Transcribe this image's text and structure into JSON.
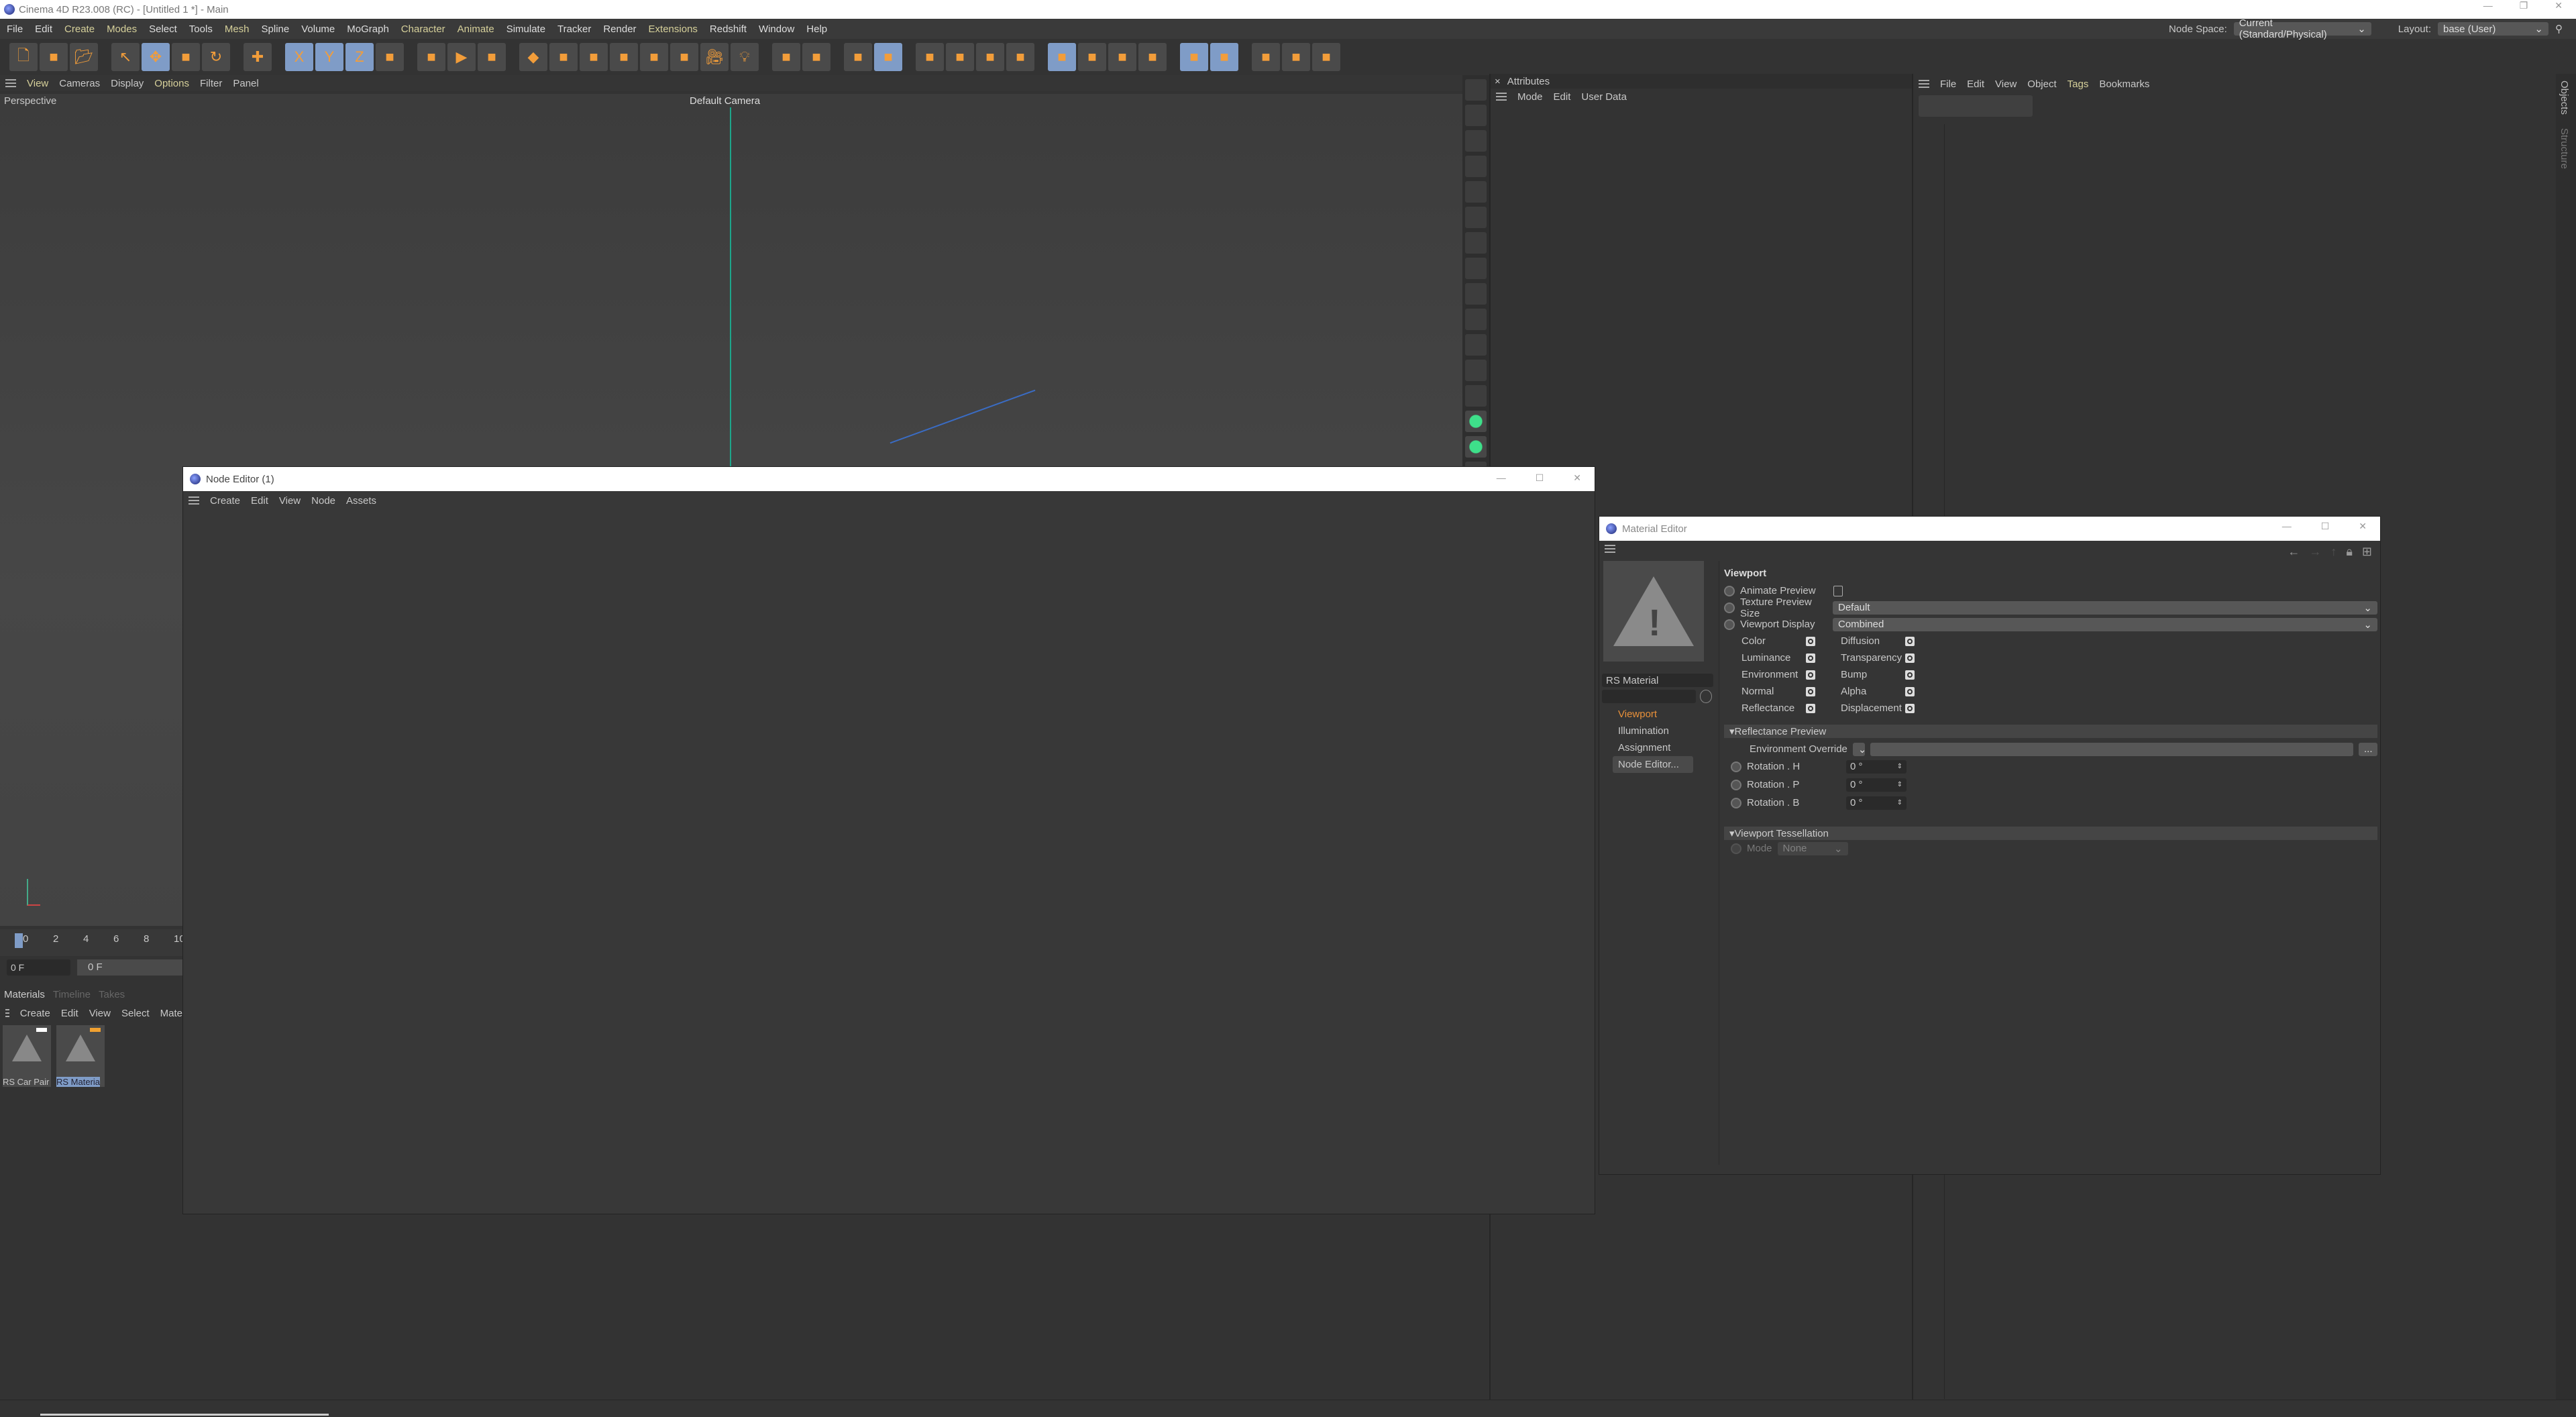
{
  "app": {
    "title": "Cinema 4D R23.008 (RC) - [Untitled 1 *] - Main"
  },
  "menu": [
    {
      "label": "File"
    },
    {
      "label": "Edit"
    },
    {
      "label": "Create",
      "y": true
    },
    {
      "label": "Modes",
      "y": true
    },
    {
      "label": "Select"
    },
    {
      "label": "Tools"
    },
    {
      "label": "Mesh",
      "y": true
    },
    {
      "label": "Spline"
    },
    {
      "label": "Volume"
    },
    {
      "label": "MoGraph"
    },
    {
      "label": "Character",
      "y": true
    },
    {
      "label": "Animate",
      "y": true
    },
    {
      "label": "Simulate"
    },
    {
      "label": "Tracker"
    },
    {
      "label": "Render"
    },
    {
      "label": "Extensions",
      "y": true
    },
    {
      "label": "Redshift"
    },
    {
      "label": "Window"
    },
    {
      "label": "Help"
    }
  ],
  "node_space": {
    "label": "Node Space:",
    "value": "Current (Standard/Physical)"
  },
  "layout": {
    "label": "Layout:",
    "value": "base (User)"
  },
  "toolbar_icons": [
    "new-scene-icon",
    "recent-icon",
    "open-icon",
    "|",
    "selection-icon",
    "move-icon",
    "scale-icon",
    "rotate-icon",
    "|",
    "axis-icon",
    "|",
    "x-axis-icon",
    "y-axis-icon",
    "z-axis-icon",
    "coordinate-icon",
    "|",
    "render-view-icon",
    "render-icon",
    "render-settings-icon",
    "|",
    "cube-icon",
    "pen-icon",
    "subdivision-icon",
    "cloner-icon",
    "deformer-icon",
    "floor-icon",
    "camera-icon",
    "light-icon",
    "|",
    "joint-icon",
    "recycle-icon",
    "|",
    "redshift-camera-icon",
    "render-view-redshift-icon",
    "|",
    "model-mode-icon",
    "points-icon",
    "edges-icon",
    "polygons-icon",
    "|",
    "object-mode-icon",
    "texture-icon",
    "uv-icon",
    "axis-mode-icon",
    "|",
    "snap-icon",
    "snap-s-icon",
    "|",
    "workplane-icon",
    "grid-icon",
    "brace-icon"
  ],
  "viewport": {
    "menu": [
      "View",
      "Cameras",
      "Display",
      "Options",
      "Filter",
      "Panel"
    ],
    "label": "Perspective",
    "camera": "Default Camera"
  },
  "attributes": {
    "title": "Attributes",
    "menu": [
      "Mode",
      "Edit",
      "User Data"
    ]
  },
  "objects": {
    "menu": [
      "File",
      "Edit",
      "View",
      "Object",
      "Tags",
      "Bookmarks"
    ],
    "side_tabs": [
      "Objects",
      "Structure"
    ]
  },
  "timeline": {
    "ticks": [
      "0",
      "2",
      "4",
      "6",
      "8",
      "10"
    ],
    "current_frame": "0 F",
    "start_frame": "0 F"
  },
  "materials": {
    "tabs": [
      "Materials",
      "Timeline",
      "Takes"
    ],
    "menu": [
      "Create",
      "Edit",
      "View",
      "Select",
      "Mate"
    ],
    "items": [
      {
        "name": "RS Car Pair",
        "tag_color": "#ffffff"
      },
      {
        "name": "RS Materia",
        "tag_color": "#f0a030",
        "selected": true
      }
    ]
  },
  "node_editor": {
    "title": "Node Editor (1)",
    "menu": [
      "Create",
      "Edit",
      "View",
      "Node",
      "Assets"
    ]
  },
  "material_editor": {
    "title": "Material Editor",
    "material_name": "RS Material",
    "nav": [
      {
        "label": "Viewport",
        "active": true
      },
      {
        "label": "Illumination"
      },
      {
        "label": "Assignment"
      },
      {
        "label": "Node Editor..."
      }
    ],
    "section": "Viewport",
    "animate_preview": "Animate Preview",
    "animate_checked": false,
    "texture_preview_label": "Texture Preview Size",
    "texture_preview_value": "Default",
    "viewport_display_label": "Viewport Display",
    "viewport_display_value": "Combined",
    "channels_left": [
      "Color",
      "Luminance",
      "Environment",
      "Normal",
      "Reflectance"
    ],
    "channels_right": [
      "Diffusion",
      "Transparency",
      "Bump",
      "Alpha",
      "Displacement"
    ],
    "reflectance_section": "Reflectance Preview",
    "env_override": "Environment Override",
    "env_button": "...",
    "rotations": [
      {
        "label": "Rotation . H",
        "value": "0 °"
      },
      {
        "label": "Rotation . P",
        "value": "0 °"
      },
      {
        "label": "Rotation . B",
        "value": "0 °"
      }
    ],
    "tess_section": "Viewport Tessellation",
    "mode_label": "Mode",
    "mode_value": "None"
  },
  "colors": {
    "accent": "#f29d3a",
    "selection": "#7f9cc7",
    "active_nav": "#e8903a"
  }
}
